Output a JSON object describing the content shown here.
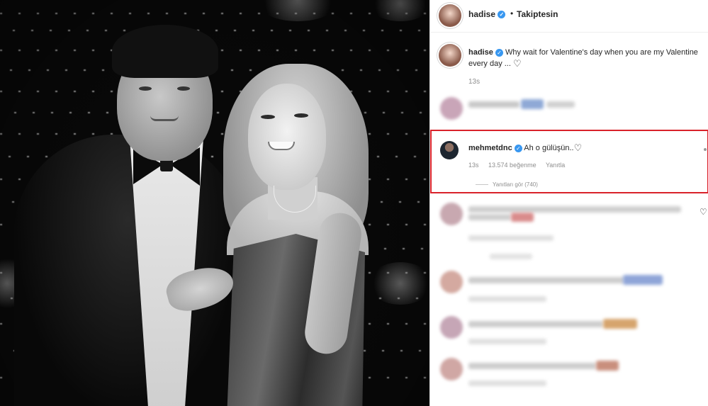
{
  "post": {
    "author": "hadise",
    "follow_status": "Takiptesin",
    "caption": "Why wait for Valentine's day when you are my Valentine every day ...",
    "caption_time": "13s"
  },
  "highlighted_comment": {
    "author": "mehmetdnc",
    "text": "Ah o gülüşün..",
    "time": "13s",
    "likes": "13.574 beğenme",
    "reply_label": "Yanıtla",
    "view_replies": "Yanıtları gör (740)"
  },
  "icons": {
    "verified": "verified-badge-icon",
    "heart": "heart-outline-icon"
  },
  "colors": {
    "highlight_border": "#d9222a",
    "verified": "#3897f0"
  }
}
